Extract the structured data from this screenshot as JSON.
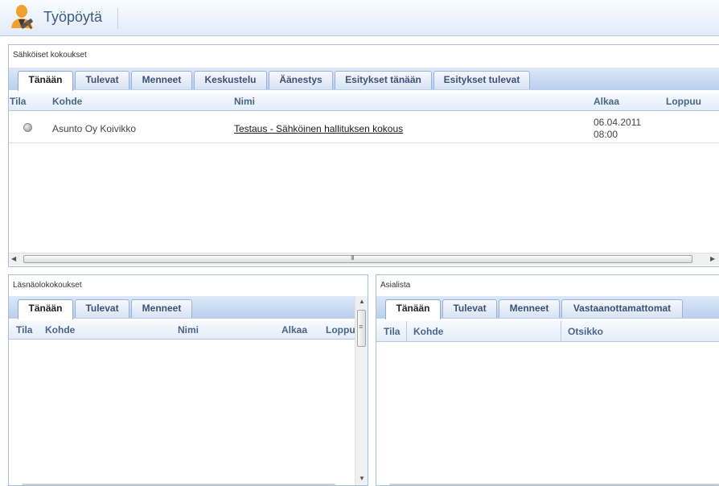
{
  "header": {
    "title": "Työpöytä"
  },
  "electronic_meetings": {
    "title": "Sähköiset kokoukset",
    "tabs": [
      "Tänään",
      "Tulevat",
      "Menneet",
      "Keskustelu",
      "Äänestys",
      "Esitykset tänään",
      "Esitykset tulevat"
    ],
    "columns": [
      "Tila",
      "Kohde",
      "Nimi",
      "Alkaa",
      "Loppuu"
    ],
    "rows": [
      {
        "target": "Asunto Oy Koivikko",
        "name": "Testaus - Sähköinen hallituksen kokous",
        "start_date": "06.04.2011",
        "start_time": "08:00",
        "end": ""
      }
    ],
    "scroll_grip": "III"
  },
  "physical_meetings": {
    "title": "Läsnäolokokoukset",
    "tabs": [
      "Tänään",
      "Tulevat",
      "Menneet"
    ],
    "columns": [
      "Tila",
      "Kohde",
      "Nimi",
      "Alkaa",
      "Loppuu"
    ]
  },
  "agenda": {
    "title": "Asialista",
    "tabs": [
      "Tänään",
      "Tulevat",
      "Menneet",
      "Vastaanottamattomat"
    ],
    "columns": [
      "Tila",
      "Kohde",
      "Otsikko"
    ]
  }
}
